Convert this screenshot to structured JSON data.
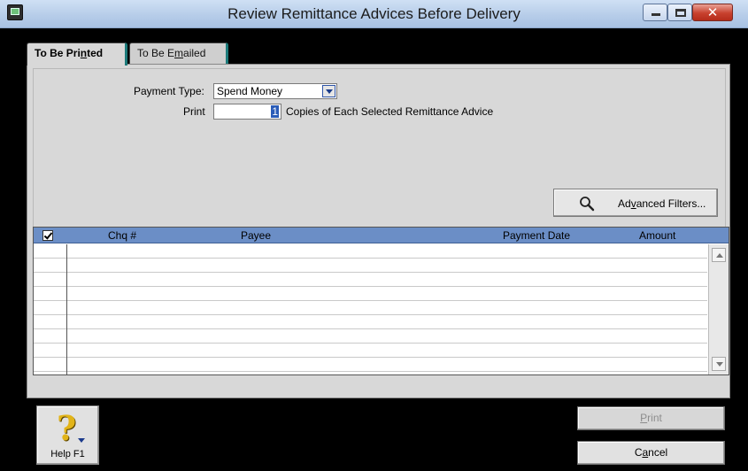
{
  "window": {
    "title": "Review Remittance Advices Before Delivery"
  },
  "tabs": [
    {
      "label_pre": "To Be Pri",
      "label_u": "n",
      "label_post": "ted"
    },
    {
      "label_pre": "To Be E",
      "label_u": "m",
      "label_post": "ailed"
    }
  ],
  "form": {
    "payment_type_label": "Payment Type:",
    "payment_type_value": "Spend Money",
    "print_label": "Print",
    "copies_value": "1",
    "copies_suffix": "Copies of Each Selected Remittance Advice"
  },
  "advanced_filters": {
    "label_pre": "Ad",
    "label_u": "v",
    "label_post": "anced Filters..."
  },
  "table": {
    "columns": [
      "Chq #",
      "Payee",
      "Payment Date",
      "Amount"
    ],
    "rows": []
  },
  "footer": {
    "help_label": "Help F1",
    "print_pre": "",
    "print_u": "P",
    "print_post": "rint",
    "cancel_pre": "C",
    "cancel_u": "a",
    "cancel_post": "ncel"
  },
  "colors": {
    "header_bg": "#6b8ec6",
    "tab_accent": "#1c7a7a",
    "selection": "#2a5cb8"
  },
  "icons": [
    "app-monitor-icon",
    "minimize-icon",
    "maximize-icon",
    "close-icon",
    "dropdown-arrow-icon",
    "magnifier-icon",
    "select-all-checkbox-icon",
    "help-question-icon",
    "scroll-up-icon",
    "scroll-down-icon"
  ]
}
